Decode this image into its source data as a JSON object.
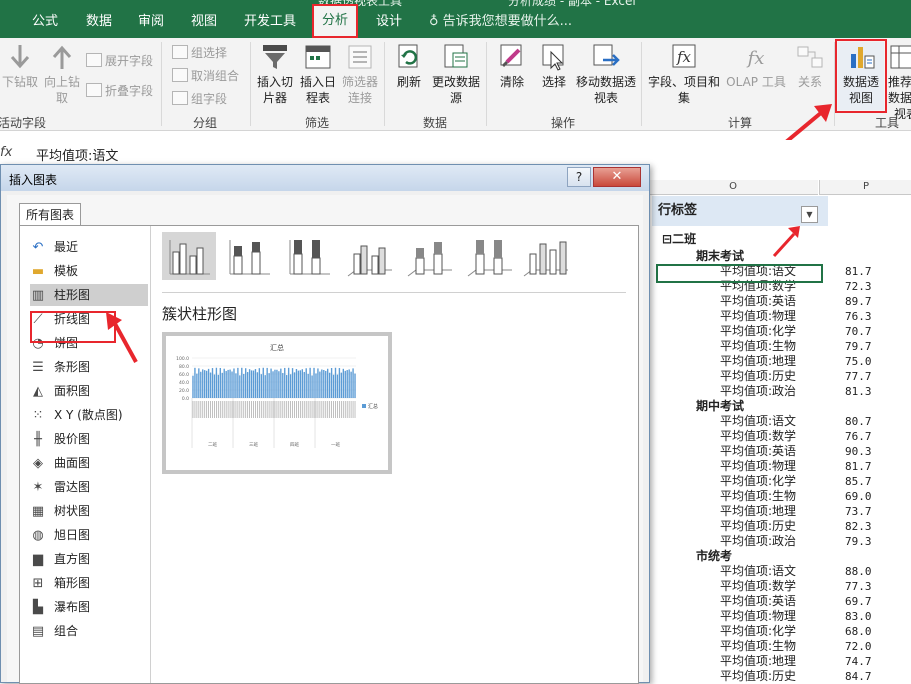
{
  "ribbon": {
    "top_cut_left": "数据透视表工具",
    "top_cut_right": "分析成绩 - 副本 - Excel",
    "tabs": [
      {
        "label": "公式"
      },
      {
        "label": "数据"
      },
      {
        "label": "审阅"
      },
      {
        "label": "视图"
      },
      {
        "label": "开发工具"
      },
      {
        "label": "分析"
      },
      {
        "label": "设计"
      }
    ],
    "tell_me": "告诉我您想要做什么...",
    "groups": {
      "active_field": {
        "label": "活动字段",
        "drill_down": "下钻取",
        "drill_up": "向上钻取",
        "expand": "展开字段",
        "collapse": "折叠字段"
      },
      "group": {
        "label": "分组",
        "group_selection": "组选择",
        "ungroup": "取消组合",
        "group_field": "组字段"
      },
      "filter": {
        "label": "筛选",
        "insert_slicer": "插入切片器",
        "insert_timeline": "插入日程表",
        "filter_connections": "筛选器连接"
      },
      "data": {
        "label": "数据",
        "refresh": "刷新",
        "change_source": "更改数据源"
      },
      "actions": {
        "label": "操作",
        "clear": "清除",
        "select": "选择",
        "move": "移动数据透视表"
      },
      "calculations": {
        "label": "计算",
        "fields_items": "字段、项目和集",
        "olap": "OLAP 工具",
        "relationships": "关系"
      },
      "tools": {
        "label": "工具",
        "pivot_chart": "数据透视图",
        "recommended": "推荐的数据透视表"
      }
    }
  },
  "formula_bar": {
    "fx": "fx",
    "content": "平均值项:语文"
  },
  "sheet": {
    "col_o": "O",
    "col_p": "P",
    "row_label_header": "行标签",
    "group": "二班",
    "sections": [
      {
        "name": "期末考试",
        "rows": [
          {
            "label": "平均值项:语文",
            "value": "81.7"
          },
          {
            "label": "平均值项:数学",
            "value": "72.3"
          },
          {
            "label": "平均值项:英语",
            "value": "89.7"
          },
          {
            "label": "平均值项:物理",
            "value": "76.3"
          },
          {
            "label": "平均值项:化学",
            "value": "70.7"
          },
          {
            "label": "平均值项:生物",
            "value": "79.7"
          },
          {
            "label": "平均值项:地理",
            "value": "75.0"
          },
          {
            "label": "平均值项:历史",
            "value": "77.7"
          },
          {
            "label": "平均值项:政治",
            "value": "81.3"
          }
        ]
      },
      {
        "name": "期中考试",
        "rows": [
          {
            "label": "平均值项:语文",
            "value": "80.7"
          },
          {
            "label": "平均值项:数学",
            "value": "76.7"
          },
          {
            "label": "平均值项:英语",
            "value": "90.3"
          },
          {
            "label": "平均值项:物理",
            "value": "81.7"
          },
          {
            "label": "平均值项:化学",
            "value": "85.7"
          },
          {
            "label": "平均值项:生物",
            "value": "69.0"
          },
          {
            "label": "平均值项:地理",
            "value": "73.7"
          },
          {
            "label": "平均值项:历史",
            "value": "82.3"
          },
          {
            "label": "平均值项:政治",
            "value": "79.3"
          }
        ]
      },
      {
        "name": "市统考",
        "rows": [
          {
            "label": "平均值项:语文",
            "value": "88.0"
          },
          {
            "label": "平均值项:数学",
            "value": "77.3"
          },
          {
            "label": "平均值项:英语",
            "value": "69.7"
          },
          {
            "label": "平均值项:物理",
            "value": "83.0"
          },
          {
            "label": "平均值项:化学",
            "value": "68.0"
          },
          {
            "label": "平均值项:生物",
            "value": "72.0"
          },
          {
            "label": "平均值项:地理",
            "value": "74.7"
          },
          {
            "label": "平均值项:历史",
            "value": "84.7"
          }
        ]
      }
    ]
  },
  "dialog": {
    "title": "插入图表",
    "help": "?",
    "close": "✕",
    "tab_all": "所有图表",
    "chart_types": [
      {
        "label": "最近",
        "icon": "recent-icon"
      },
      {
        "label": "模板",
        "icon": "folder-icon"
      },
      {
        "label": "柱形图",
        "icon": "column-chart-icon"
      },
      {
        "label": "折线图",
        "icon": "line-chart-icon"
      },
      {
        "label": "饼图",
        "icon": "pie-chart-icon"
      },
      {
        "label": "条形图",
        "icon": "bar-chart-icon"
      },
      {
        "label": "面积图",
        "icon": "area-chart-icon"
      },
      {
        "label": "X Y (散点图)",
        "icon": "scatter-chart-icon"
      },
      {
        "label": "股价图",
        "icon": "stock-chart-icon"
      },
      {
        "label": "曲面图",
        "icon": "surface-chart-icon"
      },
      {
        "label": "雷达图",
        "icon": "radar-chart-icon"
      },
      {
        "label": "树状图",
        "icon": "treemap-chart-icon"
      },
      {
        "label": "旭日图",
        "icon": "sunburst-chart-icon"
      },
      {
        "label": "直方图",
        "icon": "histogram-chart-icon"
      },
      {
        "label": "箱形图",
        "icon": "box-chart-icon"
      },
      {
        "label": "瀑布图",
        "icon": "waterfall-chart-icon"
      },
      {
        "label": "组合",
        "icon": "combo-chart-icon"
      }
    ],
    "selected_type": "柱形图",
    "subtype_title": "簇状柱形图",
    "preview": {
      "title": "汇总",
      "legend": "汇总",
      "yticks": [
        "100.0",
        "80.0",
        "60.0",
        "40.0",
        "20.0",
        "0.0"
      ],
      "groups": [
        "二班",
        "三班",
        "四班",
        "一班"
      ]
    }
  },
  "colors": {
    "excel_green": "#217346",
    "highlight_red": "#e8262d"
  }
}
